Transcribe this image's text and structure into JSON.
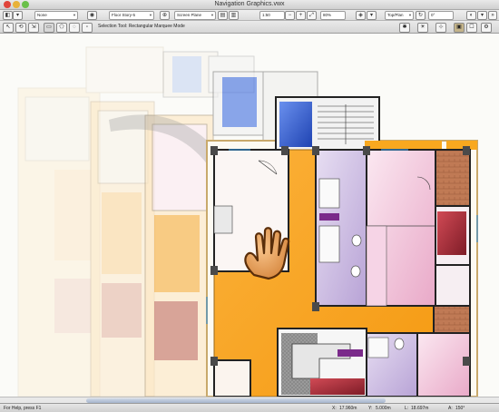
{
  "window": {
    "title": "Navigation Graphics.vwx"
  },
  "toolbar": {
    "class_value": "None",
    "layer_value": "Floor Story-5",
    "plane_value": "Screen Plane",
    "scale_value": "1:50",
    "zoom_value": "80%",
    "view_value": "Top/Plan",
    "angle_value": "0°"
  },
  "mode_bar": {
    "status_text": "Selection Tool: Rectangular Marquee Mode"
  },
  "status_bar": {
    "help_text": "For Help, press F1",
    "x_label": "X:",
    "x_value": "17.960m",
    "y_label": "Y:",
    "y_value": "5.000m",
    "l_label": "L:",
    "l_value": "18.697m",
    "a_label": "A:",
    "a_value": "150°"
  },
  "colors": {
    "orange_floor": "#f9a620",
    "purple_room": "#c9b6e0",
    "pink_room": "#f1c6dc",
    "red_room": "#b8303c",
    "brown_room": "#bf7450",
    "blue_stair": "#2e5fd6",
    "wall": "#333333"
  },
  "icons": {
    "hand_cursor": "hand-pan-icon"
  }
}
